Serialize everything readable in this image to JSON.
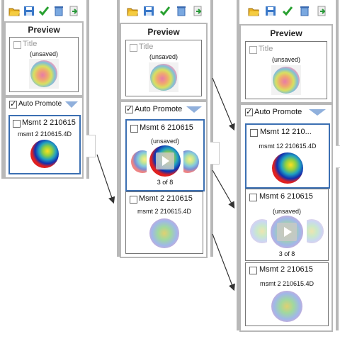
{
  "colors": {
    "accent": "#3b6fb2",
    "panel_border": "#b8b8b8",
    "dropdown_arrow": "#90b0dc"
  },
  "toolbar": {
    "icons": [
      "open-folder-icon",
      "save-icon",
      "checkmark-icon",
      "delete-icon",
      "export-icon"
    ]
  },
  "panels": [
    {
      "preview": {
        "heading": "Preview",
        "title_label": "Title",
        "unsaved": "(unsaved)"
      },
      "auto_promote": {
        "label": "Auto Promote",
        "checked": true
      },
      "cards": [
        {
          "name": "Msmt 2 210615",
          "file": "msmt 2 210615.4D",
          "selected": true
        }
      ]
    },
    {
      "preview": {
        "heading": "Preview",
        "title_label": "Title",
        "unsaved": "(unsaved)"
      },
      "auto_promote": {
        "label": "Auto Promote",
        "checked": true
      },
      "cards": [
        {
          "name": "Msmt 6 210615",
          "status": "(unsaved)",
          "counter": "3 of 8",
          "selected": true
        },
        {
          "name": "Msmt 2 210615",
          "file": "msmt 2 210615.4D",
          "selected": false
        }
      ]
    },
    {
      "preview": {
        "heading": "Preview",
        "title_label": "Title",
        "unsaved": "(unsaved)"
      },
      "auto_promote": {
        "label": "Auto Promote",
        "checked": true
      },
      "cards": [
        {
          "name": "Msmt 12 210...",
          "file": "msmt 12 210615.4D",
          "selected": true
        },
        {
          "name": "Msmt 6 210615",
          "status": "(unsaved)",
          "counter": "3 of 8",
          "selected": false
        },
        {
          "name": "Msmt 2 210615",
          "file": "msmt 2 210615.4D",
          "selected": false
        }
      ]
    }
  ]
}
